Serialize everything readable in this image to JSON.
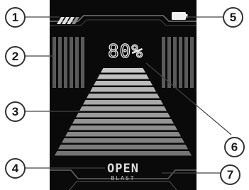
{
  "display": {
    "battery_percent_text": "80%",
    "firing_mode": "OPEN",
    "firing_submode": "BLAST"
  },
  "callouts": [
    {
      "number": "1",
      "target": "signal-indicator"
    },
    {
      "number": "2",
      "target": "side-level-bars"
    },
    {
      "number": "3",
      "target": "vapor-tunnel"
    },
    {
      "number": "4",
      "target": "firing-mode-text"
    },
    {
      "number": "5",
      "target": "battery-icon"
    },
    {
      "number": "6",
      "target": "percent-readout"
    },
    {
      "number": "7",
      "target": "submode-text"
    }
  ],
  "colors": {
    "screen_background": "#0a0a0a",
    "callout_line": "#444444",
    "callout_border": "#333333",
    "display_text": "#e8e8e8"
  }
}
